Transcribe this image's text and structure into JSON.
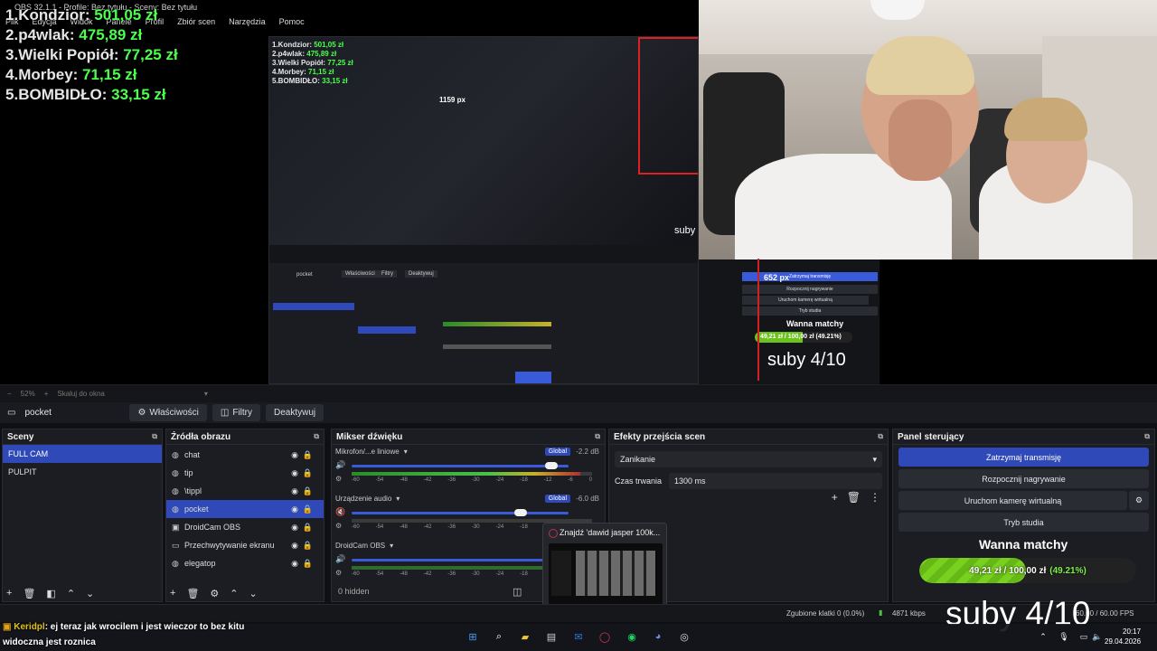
{
  "app": {
    "title": "OBS 32.1.1 - Profile: Bez tytułu - Sceny: Bez tytułu",
    "menu": [
      "Plik",
      "Edycja",
      "Widok",
      "Panele",
      "Profil",
      "Zbiór scen",
      "Narzędzia",
      "Pomoc"
    ]
  },
  "leaderboard": [
    {
      "rank": "1.",
      "name": "Kondzior:",
      "amount": "501,05 zł"
    },
    {
      "rank": "2.",
      "name": "p4wlak:",
      "amount": "475,89 zł"
    },
    {
      "rank": "3.",
      "name": "Wielki Popiół:",
      "amount": "77,25 zł"
    },
    {
      "rank": "4.",
      "name": "Morbey:",
      "amount": "71,15 zł"
    },
    {
      "rank": "5.",
      "name": "BOMBIDŁO:",
      "amount": "33,15 zł"
    }
  ],
  "preview_nested": {
    "px_width": "1159 px",
    "px_height": "652 px",
    "suby": "suby",
    "buttons": {
      "props": "Właściwości",
      "filters": "Filtry",
      "deactivate": "Deaktywuj"
    },
    "source": "pocket",
    "right_panel": {
      "stop": "Zatrzymaj transmisję",
      "record": "Rozpocznij nagrywanie",
      "vcam": "Uruchom kamerę wirtualną",
      "studio": "Tryb studia",
      "wanna": "Wanna matchy",
      "bar": "49,21 zł / 100,00 zł (49.21%)",
      "suby": "suby 4/10"
    }
  },
  "zoom": {
    "percent": "52%",
    "mode": "Skaluj do okna"
  },
  "source_toolbar": {
    "current": "pocket",
    "properties": "Właściwości",
    "filters": "Filtry",
    "deactivate": "Deaktywuj"
  },
  "scenes": {
    "title": "Sceny",
    "items": [
      {
        "label": "FULL CAM",
        "selected": true
      },
      {
        "label": "PULPIT",
        "selected": false
      }
    ]
  },
  "sources": {
    "title": "Źródła obrazu",
    "items": [
      {
        "label": "chat",
        "icon": "globe-icon",
        "selected": false
      },
      {
        "label": "tip",
        "icon": "globe-icon",
        "selected": false
      },
      {
        "label": "\\tippl",
        "icon": "globe-icon",
        "selected": false
      },
      {
        "label": "pocket",
        "icon": "globe-icon",
        "selected": true
      },
      {
        "label": "DroidCam OBS",
        "icon": "camera-icon",
        "selected": false
      },
      {
        "label": "Przechwytywanie ekranu",
        "icon": "monitor-icon",
        "selected": false
      },
      {
        "label": "elegatop",
        "icon": "globe-icon",
        "selected": false
      }
    ]
  },
  "mixer": {
    "title": "Mikser dźwięku",
    "tracks": [
      {
        "name": "Mikrofon/...e liniowe",
        "global": "Global",
        "db": "-2.2 dB",
        "level": 0.92,
        "peak": 0.95,
        "muted": false
      },
      {
        "name": "Urządzenie audio",
        "global": "Global",
        "db": "-6.0 dB",
        "level": 0.78,
        "peak": 0.0,
        "muted": true
      },
      {
        "name": "DroidCam OBS",
        "global": "",
        "db": "",
        "level": 0.0,
        "peak": 0.0,
        "muted": false
      }
    ],
    "scale": [
      "-60",
      "-54",
      "-48",
      "-42",
      "-36",
      "-30",
      "-24",
      "-18",
      "-12",
      "-6",
      "0"
    ],
    "hidden": "0 hidden"
  },
  "transitions": {
    "title": "Efekty przejścia scen",
    "selected": "Zanikanie",
    "duration_label": "Czas trwania",
    "duration_value": "1300 ms"
  },
  "controls": {
    "title": "Panel sterujący",
    "stop_stream": "Zatrzymaj transmisję",
    "start_record": "Rozpocznij nagrywanie",
    "virtual_cam": "Uruchom kamerę wirtualną",
    "studio_mode": "Tryb studia"
  },
  "overlay": {
    "goal_title": "Wanna matchy",
    "goal_amount": "49,21 zł / 100,00 zł",
    "goal_percent": "(49.21%)",
    "goal_fraction": 0.4921,
    "suby": "suby 4/10"
  },
  "status": {
    "dropped": "Zgubione klatki 0 (0.0%)",
    "bitrate": "4871 kbps",
    "fps": "60.00 / 60.00 FPS"
  },
  "chat": {
    "user": "Keridpl",
    "message": ": ej teraz jak wrocilem i jest wieczor to bez kitu",
    "message2": "widoczna jest roznica"
  },
  "popup": {
    "title": "Znajdź 'dawid jasper 100k..."
  },
  "clock": {
    "time": "20:17",
    "date": "29.04.2026"
  },
  "colors": {
    "accent": "#2f49b8",
    "money": "#4cff4c",
    "red": "#e02020"
  }
}
